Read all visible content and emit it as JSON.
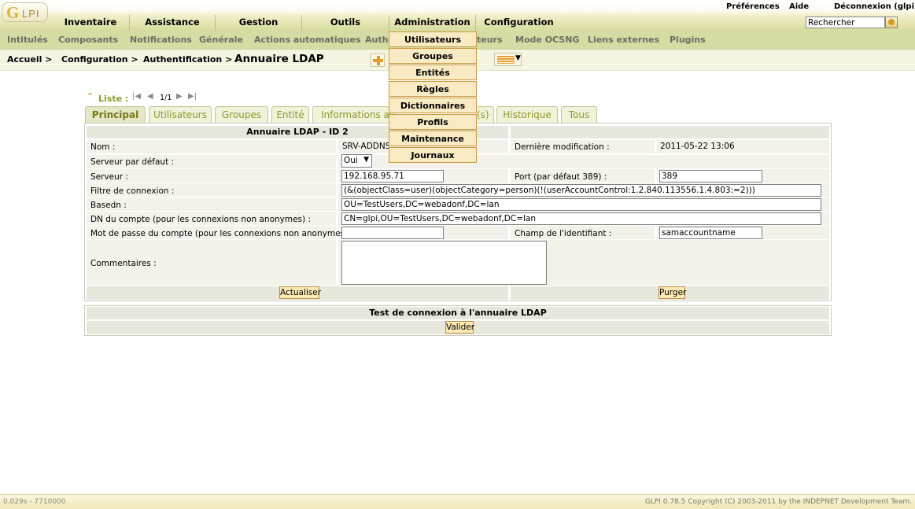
{
  "header": {
    "logo_letter": "G",
    "logo_text": "LPI",
    "links": {
      "preferences": "Préférences",
      "help": "Aide",
      "logout": "Déconnexion (glpi)"
    },
    "menu": [
      "Inventaire",
      "Assistance",
      "Gestion",
      "Outils",
      "Administration",
      "Configuration"
    ],
    "search_value": "Rechercher"
  },
  "submenu": {
    "items": [
      "Intitulés",
      "Composants",
      "Notifications",
      "Générale",
      "Actions automatiques",
      "Authe",
      "teurs",
      "Mode OCSNG",
      "Liens externes",
      "Plugins"
    ]
  },
  "breadcrumb": {
    "items": [
      "Accueil >",
      "Configuration >",
      "Authentification >"
    ],
    "title": "Annuaire LDAP"
  },
  "dropdown": {
    "items": [
      "Utilisateurs",
      "Groupes",
      "Entités",
      "Règles",
      "Dictionnaires",
      "Profils",
      "Maintenance",
      "Journaux"
    ]
  },
  "listnav": {
    "label": "Liste :",
    "count": "1/1"
  },
  "tabs": [
    "Principal",
    "Utilisateurs",
    "Groupes",
    "Entité",
    "Informations av",
    "(s)",
    "Historique",
    "Tous"
  ],
  "form": {
    "title": "Annuaire LDAP - ID 2",
    "name_label": "Nom :",
    "name_value": "SRV-ADDNS",
    "last_mod_label": "Dernière modification :",
    "last_mod_value": "2011-05-22 13:06",
    "default_server_label": "Serveur par défaut :",
    "default_server_value": "Oui",
    "server_label": "Serveur :",
    "server_value": "192.168.95.71",
    "port_label": "Port (par défaut 389) :",
    "port_value": "389",
    "filter_label": "Filtre de connexion :",
    "filter_value": "(&(objectClass=user)(objectCategory=person)(!(userAccountControl:1.2.840.113556.1.4.803:=2)))",
    "basedn_label": "Basedn :",
    "basedn_value": "OU=TestUsers,DC=webadonf,DC=lan",
    "dn_label": "DN du compte (pour les connexions non anonymes) :",
    "dn_value": "CN=glpi,OU=TestUsers,DC=webadonf,DC=lan",
    "password_label": "Mot de passe du compte (pour les connexions non anonymes) :",
    "password_value": "",
    "login_field_label": "Champ de l'identifiant :",
    "login_field_value": "samaccountname",
    "comments_label": "Commentaires :",
    "update_button": "Actualiser",
    "purge_button": "Purger"
  },
  "test": {
    "title": "Test de connexion à l'annuaire LDAP",
    "validate_button": "Valider"
  },
  "footer": {
    "left": "0.029s - 7710000",
    "right": "GLPI 0.78.5 Copyright (C) 2003-2011 by the INDEPNET Development Team."
  }
}
